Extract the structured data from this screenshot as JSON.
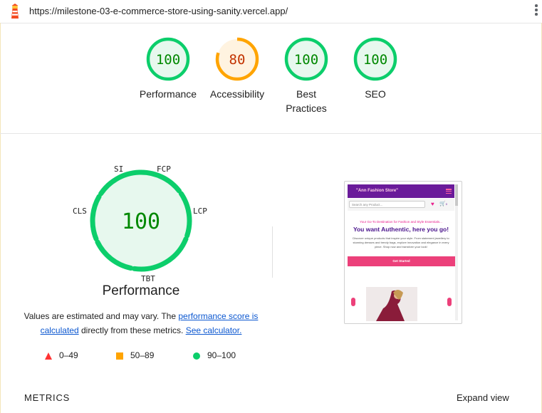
{
  "browser": {
    "url": "https://milestone-03-e-commerce-store-using-sanity.vercel.app/",
    "logo_icon": "lighthouse-icon",
    "menu_icon": "kebab-menu-icon"
  },
  "summary_gauges": [
    {
      "score": "100",
      "label": "Performance",
      "status": "pass"
    },
    {
      "score": "80",
      "label": "Accessibility",
      "status": "average"
    },
    {
      "score": "100",
      "label": "Best Practices",
      "status": "pass"
    },
    {
      "score": "100",
      "label": "SEO",
      "status": "pass"
    }
  ],
  "performance": {
    "score": "100",
    "title": "Performance",
    "metric_tags": [
      "SI",
      "FCP",
      "LCP",
      "TBT",
      "CLS"
    ],
    "note_prefix": "Values are estimated and may vary. The ",
    "note_link_1": "performance score is calculated",
    "note_middle": " directly from these metrics. ",
    "note_link_2": "See calculator."
  },
  "legend": [
    {
      "range": "0–49",
      "shape": "triangle",
      "color": "#ff3333"
    },
    {
      "range": "50–89",
      "shape": "square",
      "color": "#ffa400"
    },
    {
      "range": "90–100",
      "shape": "circle",
      "color": "#0cce6b"
    }
  ],
  "screenshot": {
    "brand": "\"Ann Fashion Store\"",
    "search_placeholder": "Search any Product...",
    "cart_count": "0",
    "tagline": "Your Go-To Destination for Fashion and Style Essentials...",
    "hero_title": "You want Authentic, here you go!",
    "hero_desc": "Discover unique products that inspire your style. From statement jewellery to stunning dresses and trendy bags, explore innovation and elegance in every piece. Shop now and transform your look!",
    "cta": "Get Started"
  },
  "footer": {
    "metrics_label": "METRICS",
    "expand_label": "Expand view"
  },
  "colors": {
    "pass": "#0cce6b",
    "pass_fill": "#e7f8ee",
    "pass_text": "#008800",
    "average": "#ffa400",
    "average_fill": "#fff3e0",
    "average_text": "#c33300"
  }
}
